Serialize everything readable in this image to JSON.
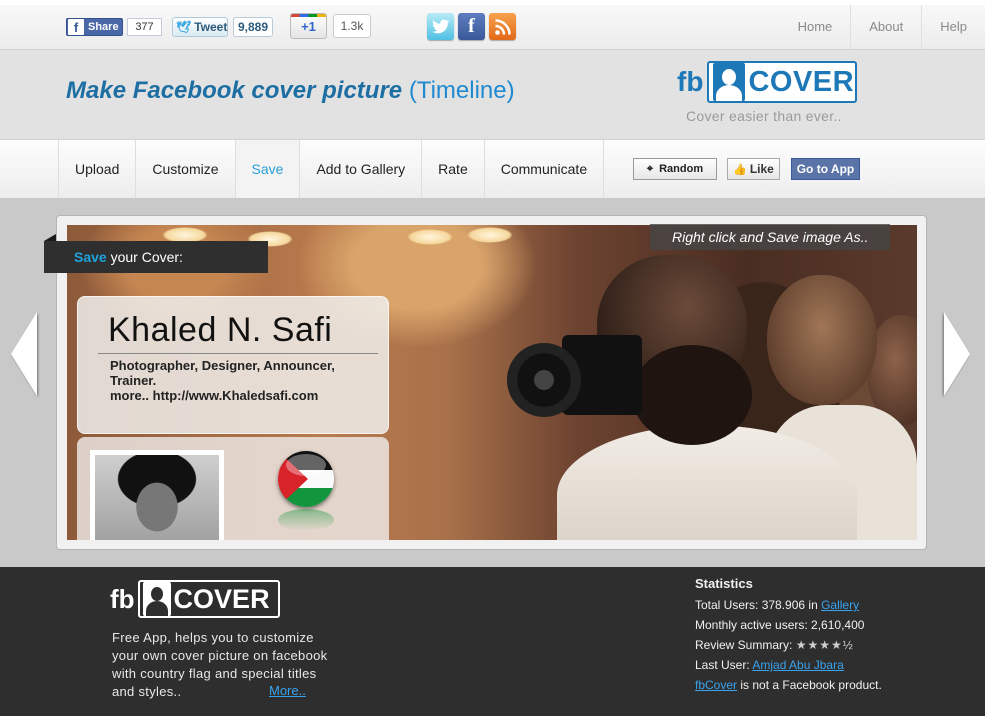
{
  "topbar": {
    "share_label": "Share",
    "share_count": "377",
    "tweet_label": "Tweet",
    "tweet_count": "9,889",
    "gplus_label": "+1",
    "gplus_count": "1.3k",
    "nav": [
      "Home",
      "About",
      "Help"
    ]
  },
  "header": {
    "title": "Make Facebook cover picture",
    "title_paren": "(Timeline)",
    "logo_fb": "fb",
    "logo_cover": "COVER",
    "tagline": "Cover easier than ever.."
  },
  "menu": {
    "items": [
      "Upload",
      "Customize",
      "Save",
      "Add to Gallery",
      "Rate",
      "Communicate"
    ],
    "active": "Save",
    "random_label": "Random",
    "like_label": "Like",
    "go_label": "Go to App"
  },
  "cover": {
    "save_word": "Save",
    "save_rest": " your Cover:",
    "right_click_hint": "Right click and Save image As..",
    "name": "Khaled N. Safi",
    "desc_line1": "Photographer, Designer, Announcer,",
    "desc_line2": "Trainer.",
    "desc_line3": "more.. http://www.Khaledsafi.com"
  },
  "footer": {
    "logo_fb": "fb",
    "logo_cover": "COVER",
    "description": "Free App, helps you to customize your own cover picture on facebook with country flag and special titles and styles..",
    "more_label": "More..",
    "stats_title": "Statistics",
    "total_users_label": "Total Users: ",
    "total_users_value": "378.906",
    "total_users_in": " in ",
    "gallery_link": "Gallery",
    "monthly_label": "Monthly active users: ",
    "monthly_value": "2,610,400",
    "review_label": "Review Summary: ",
    "review_stars": "★★★★½",
    "last_user_label": "Last User: ",
    "last_user_name": "Amjad Abu Jbara",
    "disclaimer_link": "fbCover",
    "disclaimer_rest": " is not a Facebook product."
  },
  "colors": {
    "brand_blue": "#1d78b8",
    "active_tab": "#2a9fd6",
    "footer_bg": "#2e2e2e",
    "link": "#3aa3ef"
  },
  "icons": [
    "facebook-icon",
    "twitter-bird-icon",
    "google-plus-icon",
    "twitter-icon",
    "facebook-square-icon",
    "rss-icon",
    "crosshair-icon",
    "thumbs-up-icon",
    "arrow-left-icon",
    "arrow-right-icon",
    "avatar-silhouette-icon"
  ]
}
